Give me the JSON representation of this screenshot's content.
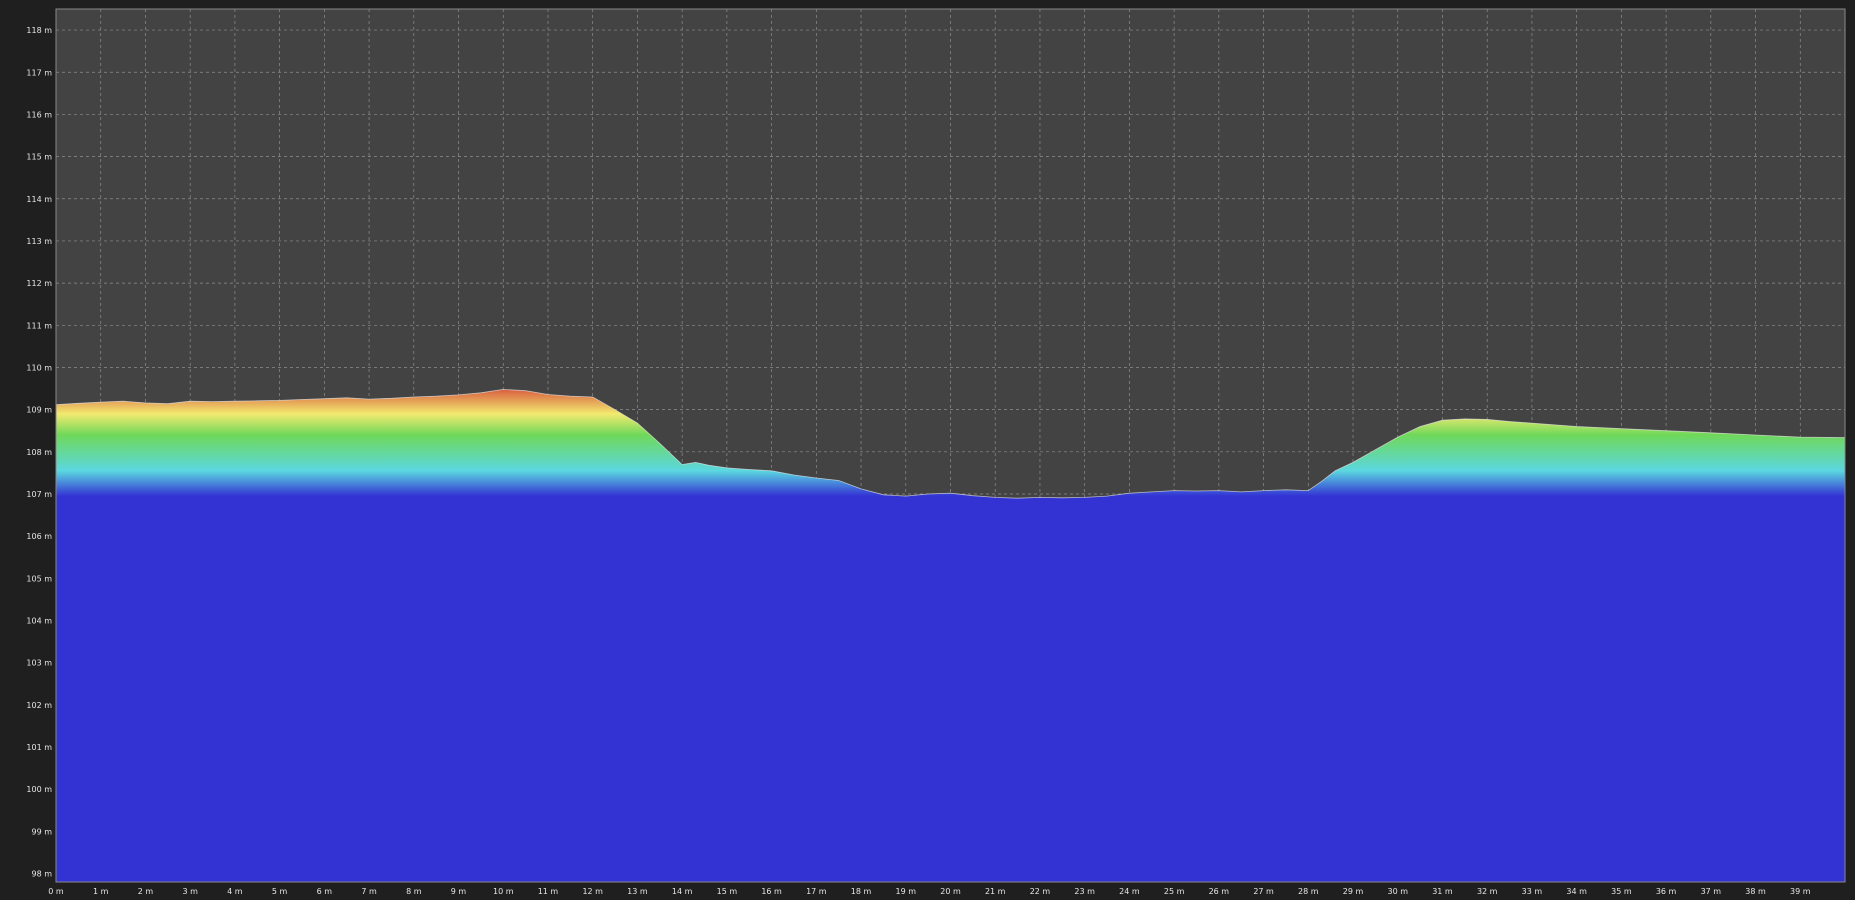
{
  "chart_data": {
    "type": "area",
    "title": "",
    "xlabel": "",
    "ylabel": "",
    "x_unit": "m",
    "y_unit": "m",
    "xlim": [
      0,
      40
    ],
    "ylim": [
      97.8,
      118.5
    ],
    "x_ticks": [
      0,
      1,
      2,
      3,
      4,
      5,
      6,
      7,
      8,
      9,
      10,
      11,
      12,
      13,
      14,
      15,
      16,
      17,
      18,
      19,
      20,
      21,
      22,
      23,
      24,
      25,
      26,
      27,
      28,
      29,
      30,
      31,
      32,
      33,
      34,
      35,
      36,
      37,
      38,
      39
    ],
    "y_ticks": [
      98,
      99,
      100,
      101,
      102,
      103,
      104,
      105,
      106,
      107,
      108,
      109,
      110,
      111,
      112,
      113,
      114,
      115,
      116,
      117,
      118
    ],
    "grid": true,
    "fill": "elevation gradient (blue low → cyan → green → yellow → red high)",
    "series": [
      {
        "x": [
          0,
          0.5,
          1,
          1.5,
          2,
          2.5,
          3,
          3.5,
          4,
          4.5,
          5,
          5.5,
          6,
          6.5,
          7,
          7.5,
          8,
          8.5,
          9,
          9.5,
          10,
          10.5,
          11,
          11.5,
          12,
          12.5,
          13,
          13.5,
          14,
          14.3,
          14.6,
          15,
          15.5,
          16,
          16.5,
          17,
          17.5,
          18,
          18.5,
          19,
          19.5,
          20,
          20.5,
          21,
          21.5,
          22,
          22.5,
          23,
          23.5,
          24,
          24.5,
          25,
          25.5,
          26,
          26.5,
          27,
          27.5,
          28,
          28.3,
          28.6,
          29,
          29.5,
          30,
          30.5,
          31,
          31.5,
          32,
          32.5,
          33,
          34,
          35,
          36,
          37,
          38,
          39,
          39.9
        ],
        "y": [
          109.12,
          109.15,
          109.18,
          109.2,
          109.16,
          109.14,
          109.2,
          109.19,
          109.2,
          109.21,
          109.22,
          109.24,
          109.26,
          109.28,
          109.25,
          109.27,
          109.3,
          109.32,
          109.35,
          109.4,
          109.48,
          109.45,
          109.36,
          109.32,
          109.3,
          109.0,
          108.68,
          108.2,
          107.7,
          107.75,
          107.68,
          107.62,
          107.58,
          107.55,
          107.45,
          107.38,
          107.32,
          107.12,
          106.98,
          106.95,
          107.0,
          107.02,
          106.96,
          106.92,
          106.9,
          106.92,
          106.91,
          106.92,
          106.95,
          107.02,
          107.05,
          107.08,
          107.07,
          107.08,
          107.05,
          107.08,
          107.1,
          107.08,
          107.3,
          107.55,
          107.75,
          108.05,
          108.35,
          108.6,
          108.75,
          108.78,
          108.77,
          108.72,
          108.68,
          108.6,
          108.55,
          108.5,
          108.45,
          108.4,
          108.35,
          108.34
        ]
      }
    ]
  },
  "colors": {
    "page_background": "#1f1f1f",
    "plot_background": "#434343",
    "grid": "#a8a8a8",
    "base_fill": "#3333d4",
    "gradient": [
      "#3333d4",
      "#5bd7e0",
      "#6fd85a",
      "#f2ea70",
      "#d85a3e"
    ]
  }
}
